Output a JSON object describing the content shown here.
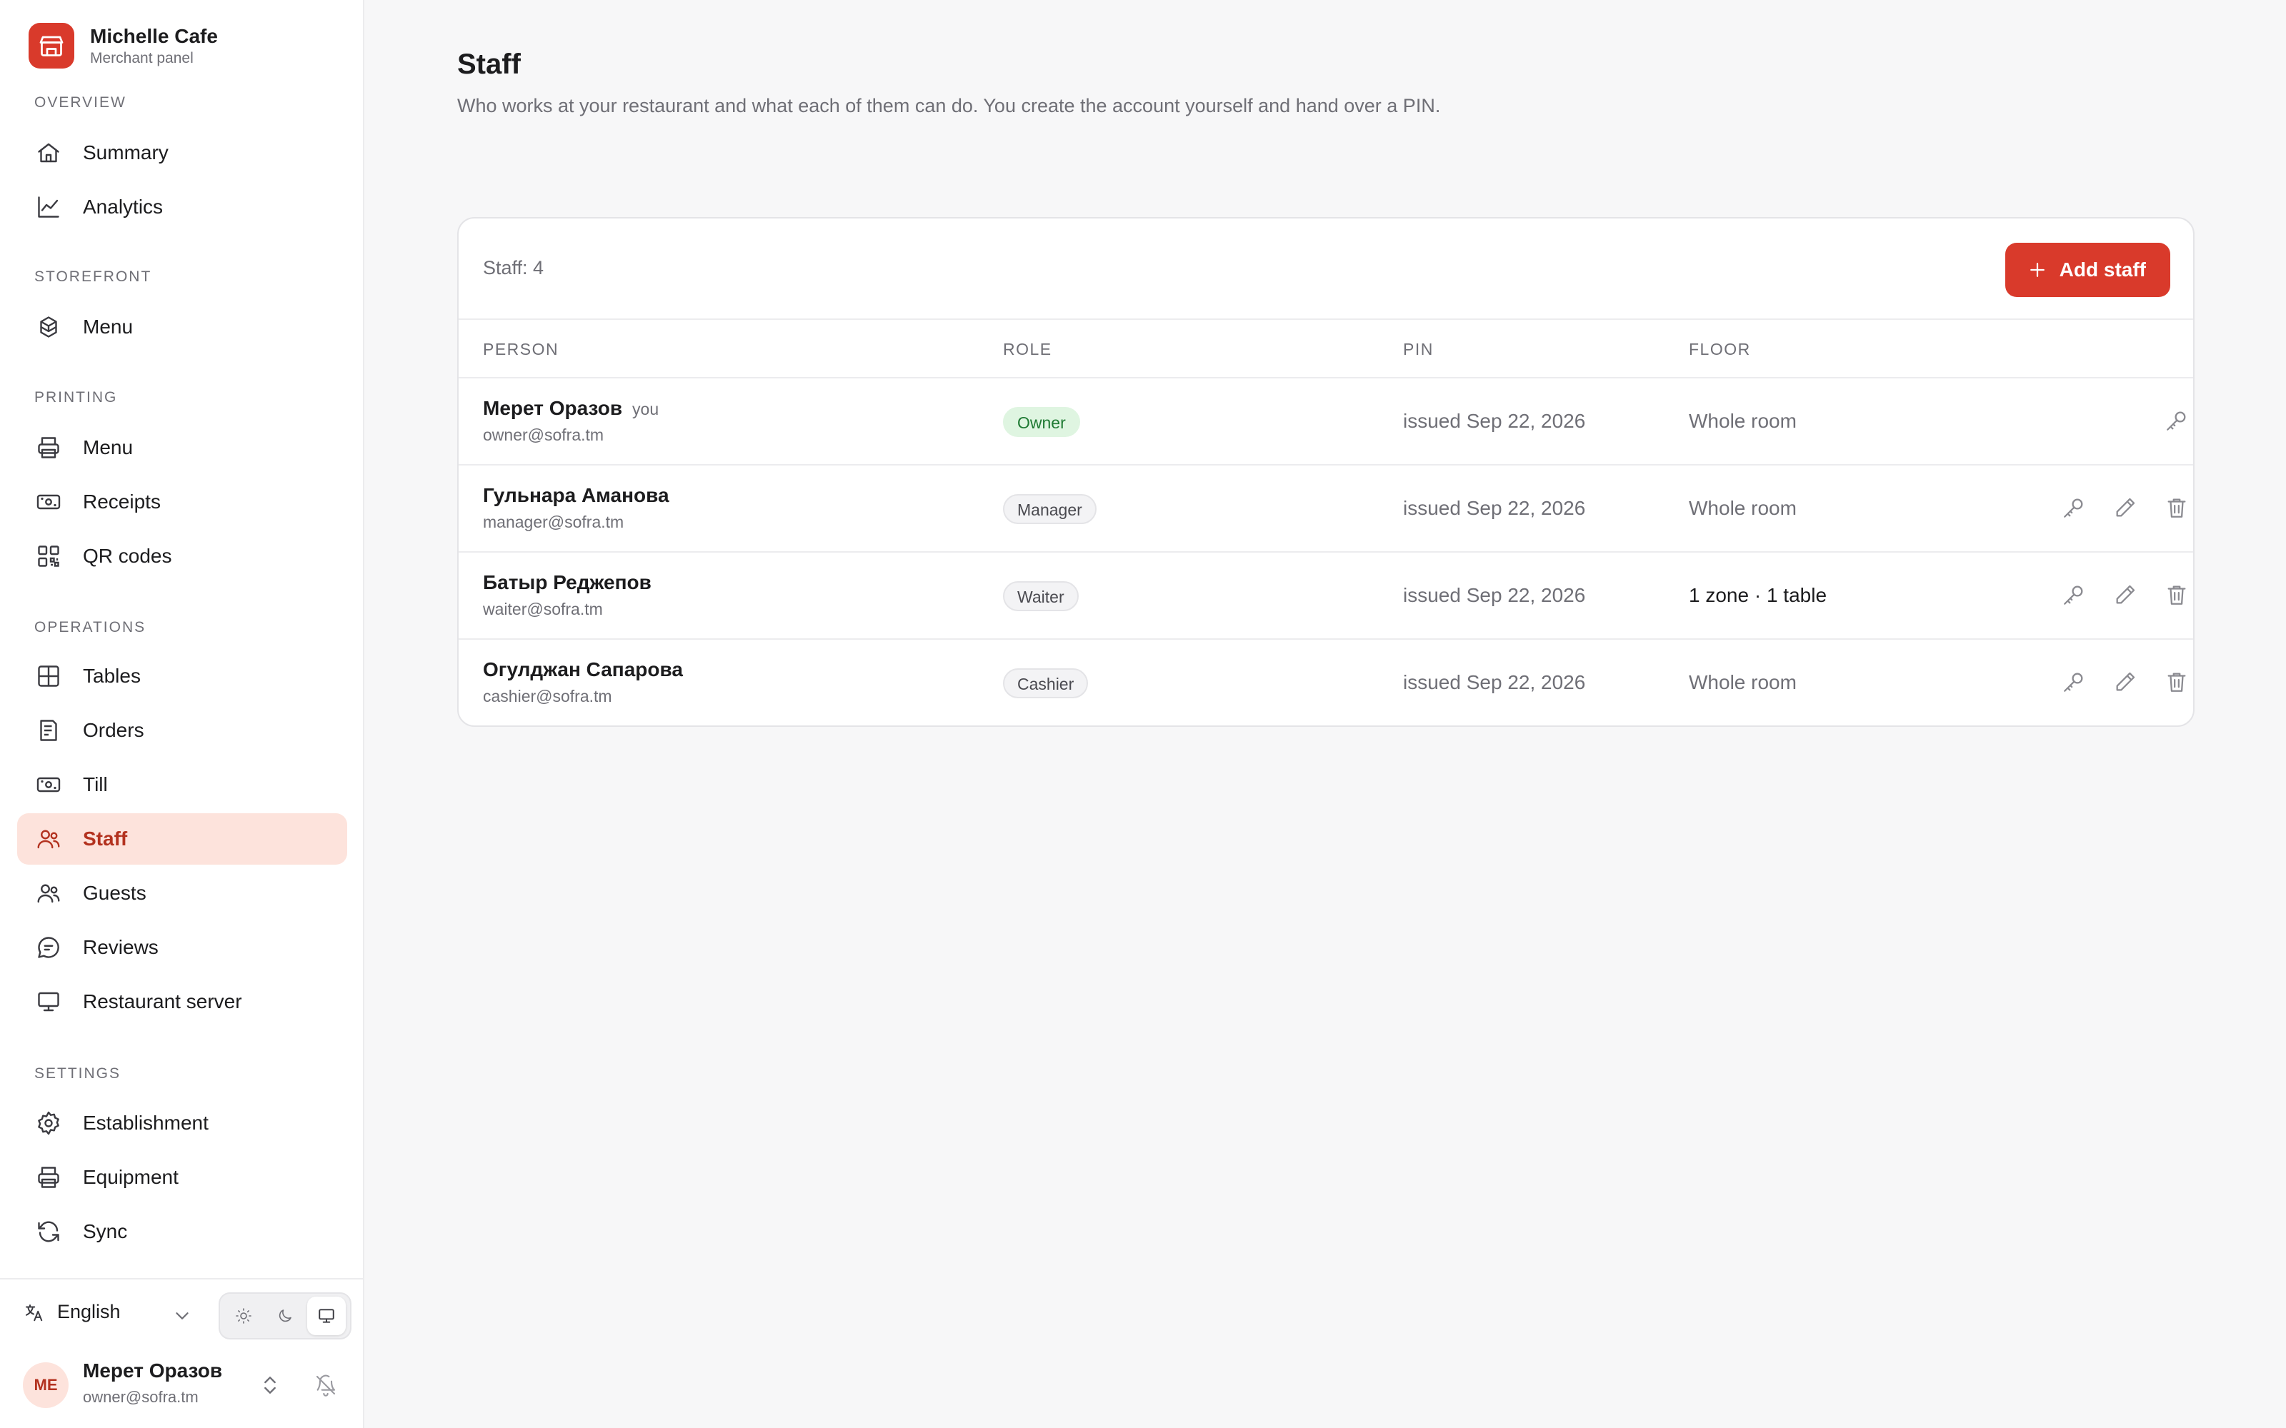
{
  "brand": {
    "name": "Michelle Cafe",
    "subtitle": "Merchant panel",
    "color": "#d93a2b"
  },
  "nav": {
    "overview_title": "OVERVIEW",
    "storefront_title": "STOREFRONT",
    "printing_title": "PRINTING",
    "operations_title": "OPERATIONS",
    "settings_title": "SETTINGS",
    "items": {
      "summary": "Summary",
      "analytics": "Analytics",
      "menu": "Menu",
      "print_menu": "Menu",
      "receipts": "Receipts",
      "qr_codes": "QR codes",
      "tables": "Tables",
      "orders": "Orders",
      "till": "Till",
      "staff": "Staff",
      "guests": "Guests",
      "reviews": "Reviews",
      "restaurant_server": "Restaurant server",
      "establishment": "Establishment",
      "equipment": "Equipment",
      "sync": "Sync"
    },
    "active": "staff",
    "active_color": "#b3321f"
  },
  "footer": {
    "language": "English",
    "theme_options": [
      "light-icon",
      "dark-icon",
      "system-icon"
    ],
    "theme_selected": "system-icon",
    "user": {
      "initials": "ME",
      "name": "Мерет Оразов",
      "email": "owner@sofra.tm"
    }
  },
  "page": {
    "title": "Staff",
    "description": "Who works at your restaurant and what each of them can do. You create the account yourself and hand over a PIN."
  },
  "staff_card": {
    "count_label": "Staff: 4",
    "add_button": "Add staff",
    "columns": {
      "person": "PERSON",
      "role": "ROLE",
      "pin": "PIN",
      "floor": "FLOOR"
    },
    "rows": [
      {
        "name": "Мерет Оразов",
        "you": "you",
        "email": "owner@sofra.tm",
        "role": "Owner",
        "pin": "issued Sep 22, 2026",
        "floor": "Whole room"
      },
      {
        "name": "Гульнара Аманова",
        "email": "manager@sofra.tm",
        "role": "Manager",
        "pin": "issued Sep 22, 2026",
        "floor": "Whole room"
      },
      {
        "name": "Батыр Реджепов",
        "email": "waiter@sofra.tm",
        "role": "Waiter",
        "pin": "issued Sep 22, 2026",
        "floor": "1 zone · 1 table"
      },
      {
        "name": "Огулджан Сапарова",
        "email": "cashier@sofra.tm",
        "role": "Cashier",
        "pin": "issued Sep 22, 2026",
        "floor": "Whole room"
      }
    ]
  }
}
